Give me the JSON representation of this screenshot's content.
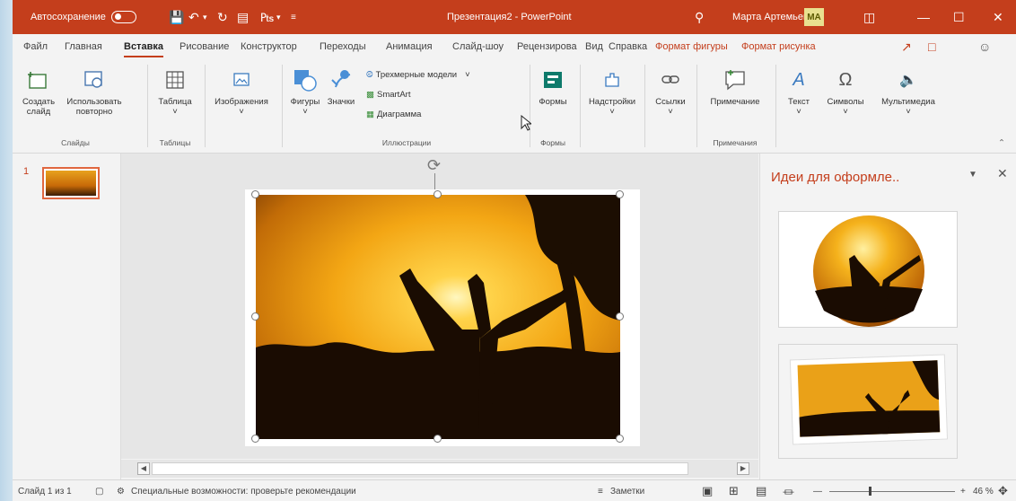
{
  "titlebar": {
    "autosave_label": "Автосохранение",
    "document_title": "Презентация2 - PowerPoint",
    "user_name": "Марта Артемьева",
    "user_initials": "МА"
  },
  "tabs": [
    "Файл",
    "Главная",
    "Вставка",
    "Рисование",
    "Конструктор",
    "Переходы",
    "Анимация",
    "Слайд-шоу",
    "Рецензирова",
    "Вид",
    "Справка",
    "Формат фигуры",
    "Формат рисунка"
  ],
  "active_tab": "Вставка",
  "ribbon": {
    "new_slide": "Создать слайд",
    "reuse_slide_1": "Использовать",
    "reuse_slide_2": "повторно",
    "table": "Таблица",
    "images": "Изображения",
    "shapes": "Фигуры",
    "icons": "Значки",
    "models_3d": "Трехмерные модели",
    "smartart": "SmartArt",
    "chart": "Диаграмма",
    "forms": "Формы",
    "addins": "Надстройки",
    "links": "Ссылки",
    "comment": "Примечание",
    "text": "Текст",
    "symbols": "Символы",
    "media": "Мультимедиа",
    "groups": {
      "slides": "Слайды",
      "tables": "Таблицы",
      "illustrations": "Иллюстрации",
      "forms": "Формы",
      "comments": "Примечания"
    }
  },
  "slides_panel": {
    "slide_number": "1"
  },
  "design_ideas": {
    "title": "Идеи для оформле.."
  },
  "status": {
    "slide_info": "Слайд 1 из 1",
    "accessibility": "Специальные возможности: проверьте рекомендации",
    "notes": "Заметки",
    "zoom": "46 %"
  },
  "colors": {
    "accent": "#c43e1c",
    "ribbon_bg": "#f3f3f3"
  }
}
